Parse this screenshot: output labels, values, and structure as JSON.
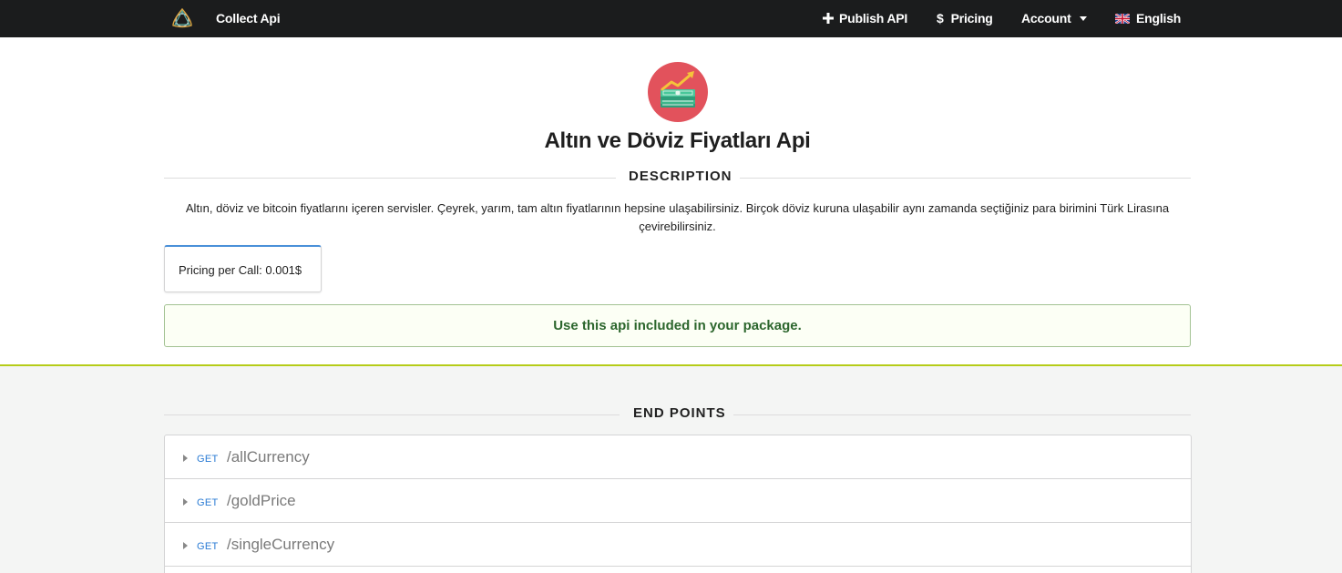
{
  "nav": {
    "brand": "Collect Api",
    "publish": "Publish API",
    "pricing": "Pricing",
    "account": "Account",
    "language": "English",
    "icons": {
      "logo": "triquetra-logo-icon",
      "publish": "plus-icon",
      "pricing": "dollar-icon",
      "account": "caret-down-icon",
      "language": "uk-flag-icon"
    }
  },
  "api": {
    "title": "Altın ve Döviz Fiyatları Api",
    "icon": "money-growth-icon"
  },
  "description": {
    "heading": "DESCRIPTION",
    "text": "Altın, döviz ve bitcoin fiyatlarını içeren servisler. Çeyrek, yarım, tam altın fiyatlarının hepsine ulaşabilirsiniz. Birçok döviz kuruna ulaşabilir aynı zamanda seçtiğiniz para birimini Türk Lirasına çevirebilirsiniz."
  },
  "pricing_card": {
    "label": "Pricing per Call: 0.001$"
  },
  "package_message": "Use this api included in your package.",
  "endpoints": {
    "heading": "END POINTS",
    "items": [
      {
        "method": "GET",
        "path": "/allCurrency"
      },
      {
        "method": "GET",
        "path": "/goldPrice"
      },
      {
        "method": "GET",
        "path": "/singleCurrency"
      }
    ]
  },
  "colors": {
    "nav_bg": "#1b1c1d",
    "accent_blue": "#4a90d9",
    "success_text": "#2c662d",
    "success_bg": "#fcfff5",
    "olive_border": "#b5cc18",
    "icon_red": "#e2525c",
    "method_blue": "#2a7bd4"
  }
}
